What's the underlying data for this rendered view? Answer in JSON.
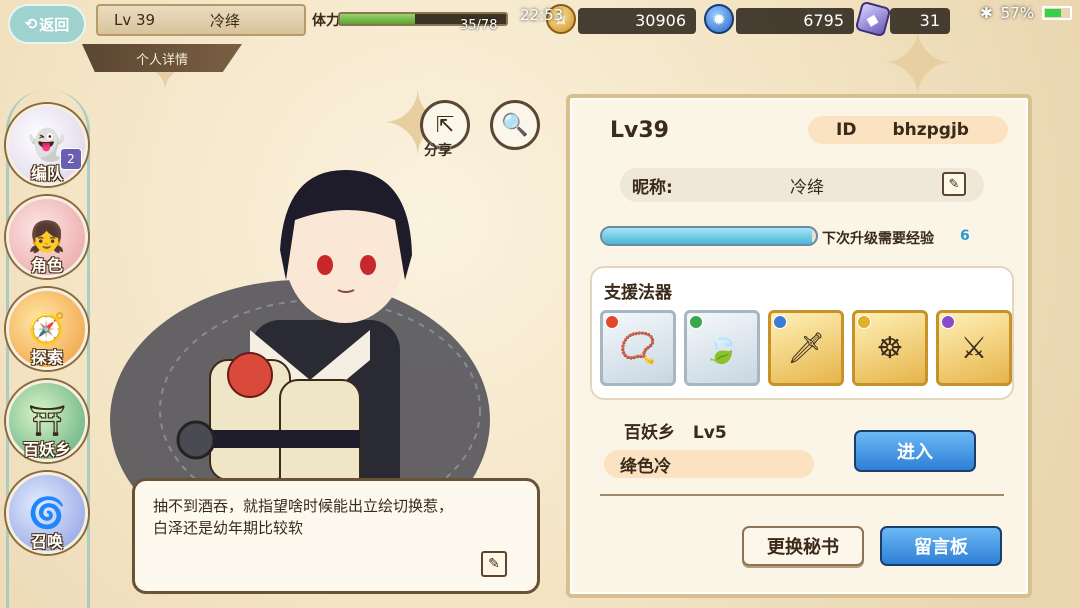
{
  "topbar": {
    "back_label": "返回",
    "player_level": "Lv 39",
    "player_name": "冷绛",
    "sub_title": "个人详情",
    "stamina_label": "体力",
    "stamina_value": "35/78",
    "stamina_fraction": 0.45,
    "clock": "22:53",
    "coins": "30906",
    "flames": "6795",
    "gems": "31",
    "battery": "57%"
  },
  "tools": {
    "share_label": "分享"
  },
  "nav": [
    {
      "label": "编队",
      "badge": "2"
    },
    {
      "label": "角色"
    },
    {
      "label": "探索"
    },
    {
      "label": "百妖乡"
    },
    {
      "label": "召唤"
    }
  ],
  "speech": {
    "line1": "抽不到酒吞，就指望啥时候能出立绘切换惹，",
    "line2": "白泽还是幼年期比较软"
  },
  "profile": {
    "level": "Lv39",
    "id_label": "ID",
    "id_value": "bhzpgjb",
    "nickname_label": "昵称:",
    "nickname": "冷绛",
    "exp_label": "下次升级需要经验",
    "exp_value": "6",
    "exp_fraction": 0.98,
    "support_title": "支援法器",
    "home_label": "百妖乡",
    "home_level": "Lv5",
    "motto": "绛色冷",
    "enter_button": "进入",
    "change_secretary_button": "更换秘书",
    "message_board_button": "留言板"
  },
  "colors": {
    "accent_blue": "#2f7fd6",
    "panel_bg": "#fbf5e8",
    "exp_value": "#2a9ad0"
  }
}
